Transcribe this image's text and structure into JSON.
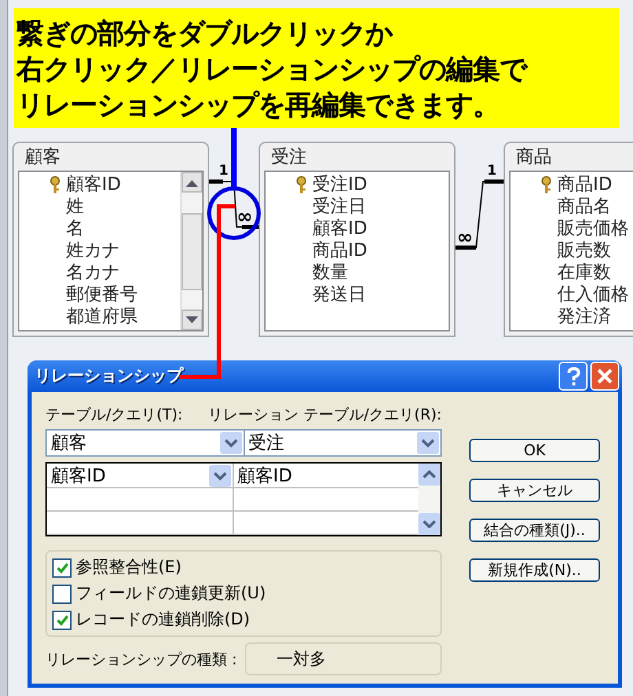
{
  "callout": {
    "lines": [
      "繋ぎの部分をダブルクリックか",
      "右クリック／リレーションシップの編集で",
      "リレーションシップを再編集できます。"
    ]
  },
  "tables": [
    {
      "title": "顧客",
      "scrollbar": true,
      "fields": [
        {
          "name": "顧客ID",
          "key": true
        },
        {
          "name": "姓",
          "key": false
        },
        {
          "name": "名",
          "key": false
        },
        {
          "name": "姓カナ",
          "key": false
        },
        {
          "name": "名カナ",
          "key": false
        },
        {
          "name": "郵便番号",
          "key": false
        },
        {
          "name": "都道府県",
          "key": false
        }
      ]
    },
    {
      "title": "受注",
      "scrollbar": false,
      "fields": [
        {
          "name": "受注ID",
          "key": true
        },
        {
          "name": "受注日",
          "key": false
        },
        {
          "name": "顧客ID",
          "key": false
        },
        {
          "name": "商品ID",
          "key": false
        },
        {
          "name": "数量",
          "key": false
        },
        {
          "name": "発送日",
          "key": false
        }
      ]
    },
    {
      "title": "商品",
      "scrollbar": false,
      "fields": [
        {
          "name": "商品ID",
          "key": true
        },
        {
          "name": "商品名",
          "key": false
        },
        {
          "name": "販売価格",
          "key": false
        },
        {
          "name": "販売数",
          "key": false
        },
        {
          "name": "在庫数",
          "key": false
        },
        {
          "name": "仕入価格",
          "key": false
        },
        {
          "name": "発注済",
          "key": false
        }
      ]
    }
  ],
  "relationships": [
    {
      "one": "1",
      "many": "∞"
    },
    {
      "one": "1",
      "many": "∞"
    }
  ],
  "dialog": {
    "title": "リレーションシップ",
    "table_label": "テーブル/クエリ(T):",
    "related_label": "リレーション テーブル/クエリ(R):",
    "table": "顧客",
    "related_table": "受注",
    "field_rows": [
      {
        "field": "顧客ID",
        "related_field": "顧客ID"
      }
    ],
    "buttons": [
      "OK",
      "キャンセル",
      "結合の種類(J)..",
      "新規作成(N).."
    ],
    "options": [
      {
        "label": "参照整合性(E)",
        "checked": true
      },
      {
        "label": "フィールドの連鎖更新(U)",
        "checked": false
      },
      {
        "label": "レコードの連鎖削除(D)",
        "checked": true
      }
    ],
    "type_label": "リレーションシップの種類 :",
    "type_value": "一対多"
  }
}
